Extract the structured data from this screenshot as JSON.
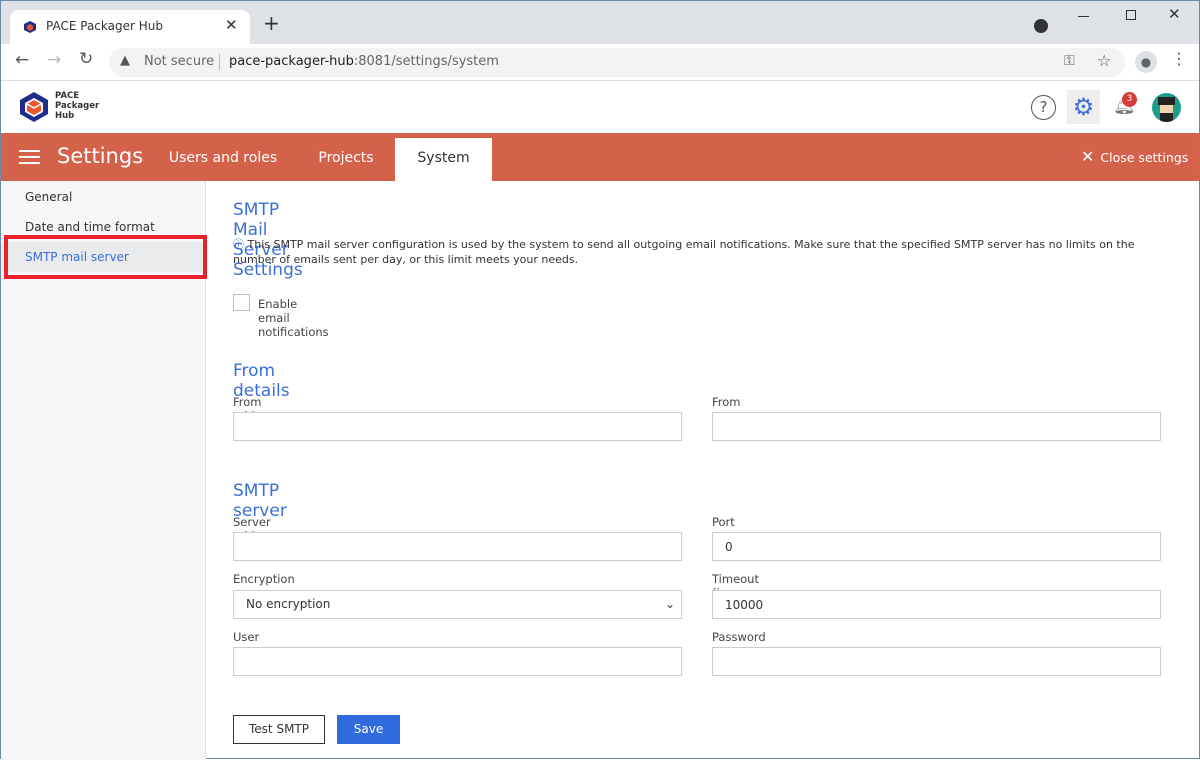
{
  "browser": {
    "tab_title": "PACE Packager Hub",
    "security": "Not secure",
    "url_host": "pace-packager-hub",
    "url_rest": ":8081/settings/system"
  },
  "app": {
    "logo_text": [
      "PACE",
      "Packager",
      "Hub"
    ],
    "notification_count": "3"
  },
  "nav": {
    "title": "Settings",
    "tabs": [
      {
        "label": "Users and roles"
      },
      {
        "label": "Projects"
      },
      {
        "label": "System",
        "active": true
      }
    ],
    "close_label": "Close settings"
  },
  "sidebar": {
    "items": [
      {
        "label": "General"
      },
      {
        "label": "Date and time format"
      },
      {
        "label": "SMTP mail server",
        "active": true
      }
    ]
  },
  "main": {
    "title": "SMTP Mail Server Settings",
    "info": "This SMTP mail server configuration is used by the system to send all outgoing email notifications. Make sure that the specified SMTP server has no limits on the number of emails sent per day, or this limit meets your needs.",
    "enable_label": "Enable email notifications",
    "enable_checked": false,
    "from_heading": "From details",
    "from_address_label": "From address",
    "from_address_value": "",
    "from_name_label": "From name",
    "from_name_value": "",
    "smtp_heading": "SMTP server",
    "server_label": "Server address",
    "server_value": "",
    "port_label": "Port",
    "port_value": "0",
    "encryption_label": "Encryption",
    "encryption_value": "No encryption",
    "timeout_label": "Timeout (in seconds)",
    "timeout_value": "10000",
    "user_label": "User name",
    "user_value": "",
    "password_label": "Password",
    "password_value": "",
    "test_label": "Test SMTP",
    "save_label": "Save"
  },
  "colors": {
    "accent": "#d4624b",
    "link": "#3a6fd8",
    "primary_button": "#2f6bdc",
    "highlight": "#e8212b"
  }
}
